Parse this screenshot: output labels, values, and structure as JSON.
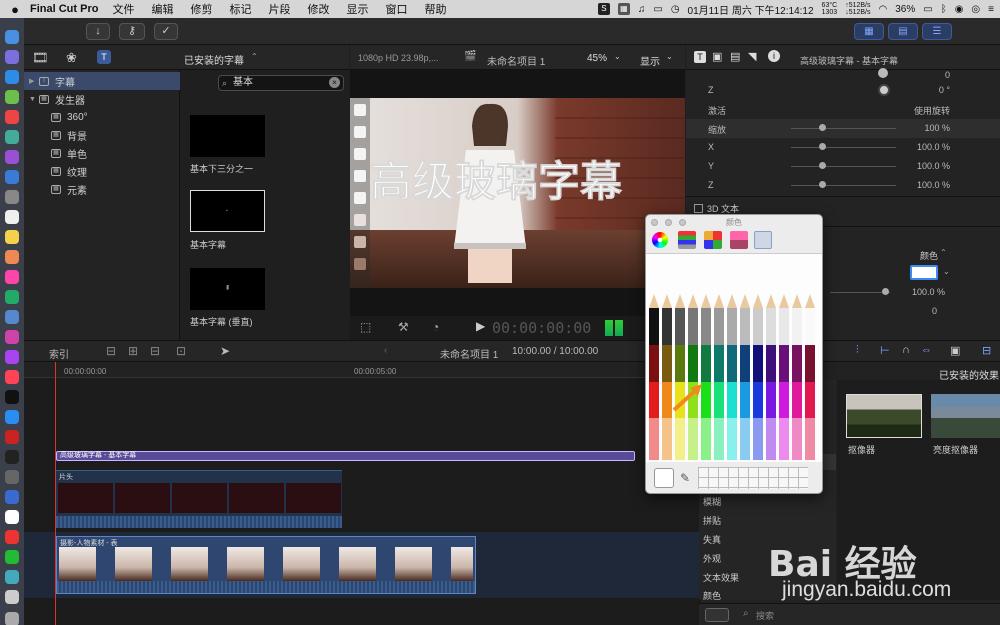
{
  "menubar": {
    "app": "Final Cut Pro",
    "items": [
      "文件",
      "编辑",
      "修剪",
      "标记",
      "片段",
      "修改",
      "显示",
      "窗口",
      "帮助"
    ],
    "temp": "63°C",
    "fan": "1303",
    "net_up": "↑512B/s",
    "net_down": "↓512B/s",
    "battery": "36%",
    "datetime": "01月11日 周六 下午12:14:12"
  },
  "browser": {
    "header_title": "已安装的字幕",
    "search_value": "基本",
    "tree": [
      {
        "label": "字幕",
        "level": 0
      },
      {
        "label": "发生器",
        "level": 0
      },
      {
        "label": "360°",
        "level": 1
      },
      {
        "label": "背景",
        "level": 1
      },
      {
        "label": "单色",
        "level": 1
      },
      {
        "label": "纹理",
        "level": 1
      },
      {
        "label": "元素",
        "level": 1
      }
    ],
    "thumbs": [
      {
        "label": "基本下三分之一"
      },
      {
        "label": "基本字幕"
      },
      {
        "label": "基本字幕 (垂直)"
      }
    ]
  },
  "viewer": {
    "format": "1080p HD 23.98p,...",
    "project": "未命名项目 1",
    "zoom": "45%",
    "display_label": "显示",
    "overlay_text": "高级玻璃字幕",
    "timecode": "00:00:00:00"
  },
  "inspector": {
    "title": "高级玻璃字幕 - 基本字幕",
    "rows": [
      {
        "label": "Z",
        "value": "0 °"
      },
      {
        "label": "激活",
        "value": "使用旋转"
      },
      {
        "label": "缩放",
        "value": "100 %"
      },
      {
        "label": "X",
        "value": "100.0 %"
      },
      {
        "label": "Y",
        "value": "100.0 %"
      },
      {
        "label": "Z",
        "value": "100.0 %"
      }
    ],
    "text3d_label": "3D 文本",
    "top_value": "0",
    "color_label": "颜色",
    "opacity_value": "100.0 %",
    "bottom_value": "0"
  },
  "timeline": {
    "index_label": "索引",
    "project": "未命名项目 1",
    "duration": "10:00.00 / 10:00.00",
    "ruler": [
      "00:00:00:00",
      "00:00:05:00"
    ],
    "title_clip": "高级玻璃字幕 - 基本字幕",
    "clip1": "片头",
    "clip2": "摄影-人物素材 - 表"
  },
  "effects": {
    "header": "已安装的效果",
    "items": [
      "模糊",
      "拼贴",
      "失真",
      "外观",
      "文本效果",
      "颜色"
    ],
    "thumbs": [
      "抠像器",
      "亮度抠像器"
    ],
    "search_placeholder": "搜索"
  },
  "color_picker": {
    "title": "颜色"
  },
  "watermark": {
    "text": "Bai 经验",
    "url": "jingyan.baidu.com"
  }
}
